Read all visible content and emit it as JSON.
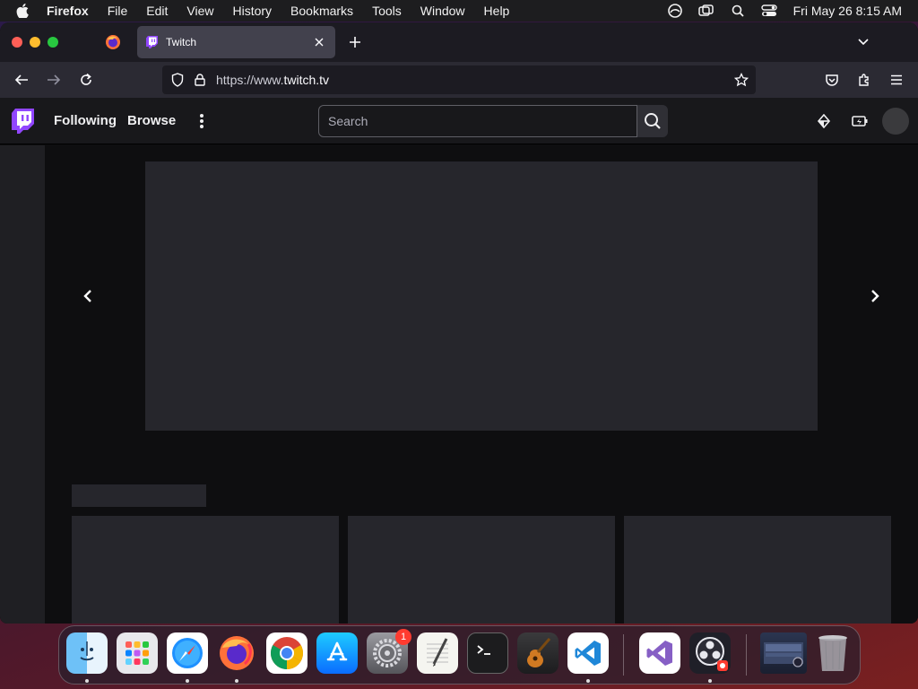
{
  "menubar": {
    "app_name": "Firefox",
    "items": [
      "File",
      "Edit",
      "View",
      "History",
      "Bookmarks",
      "Tools",
      "Window",
      "Help"
    ],
    "clock": "Fri May 26  8:15 AM",
    "status_icons": [
      "creative-cloud-icon",
      "screen-mirroring-icon",
      "spotlight-search-icon",
      "control-center-icon"
    ]
  },
  "browser": {
    "tab": {
      "title": "Twitch"
    },
    "url": {
      "prefix": "https://www.",
      "domain": "twitch.tv"
    },
    "colors": {
      "tab_active": "#42414d",
      "toolbar": "#2b2a33"
    }
  },
  "twitch": {
    "nav": {
      "following": "Following",
      "browse": "Browse"
    },
    "search": {
      "placeholder": "Search"
    },
    "colors": {
      "brand": "#9146ff",
      "background": "#0e0e10",
      "placeholder": "#26262c"
    }
  },
  "dock": {
    "apps": [
      {
        "name": "Finder",
        "icon": "finder-icon",
        "running": true
      },
      {
        "name": "Launchpad",
        "icon": "launchpad-icon",
        "running": false
      },
      {
        "name": "Safari",
        "icon": "safari-icon",
        "running": true
      },
      {
        "name": "Firefox",
        "icon": "firefox-icon",
        "running": true
      },
      {
        "name": "Google Chrome",
        "icon": "chrome-icon",
        "running": false
      },
      {
        "name": "App Store",
        "icon": "app-store-icon",
        "running": false
      },
      {
        "name": "System Preferences",
        "icon": "system-preferences-icon",
        "running": false,
        "badge": "1"
      },
      {
        "name": "TextEdit",
        "icon": "textedit-icon",
        "running": false
      },
      {
        "name": "Terminal",
        "icon": "terminal-icon",
        "running": false
      },
      {
        "name": "GarageBand",
        "icon": "garageband-icon",
        "running": false
      },
      {
        "name": "Visual Studio Code",
        "icon": "vscode-icon",
        "running": true
      },
      {
        "name": "Visual Studio",
        "icon": "visual-studio-icon",
        "running": false
      },
      {
        "name": "OBS",
        "icon": "obs-icon",
        "running": true
      },
      {
        "name": "Downloads",
        "icon": "downloads-stack-icon",
        "running": false
      },
      {
        "name": "Trash",
        "icon": "trash-icon",
        "running": false
      }
    ]
  }
}
